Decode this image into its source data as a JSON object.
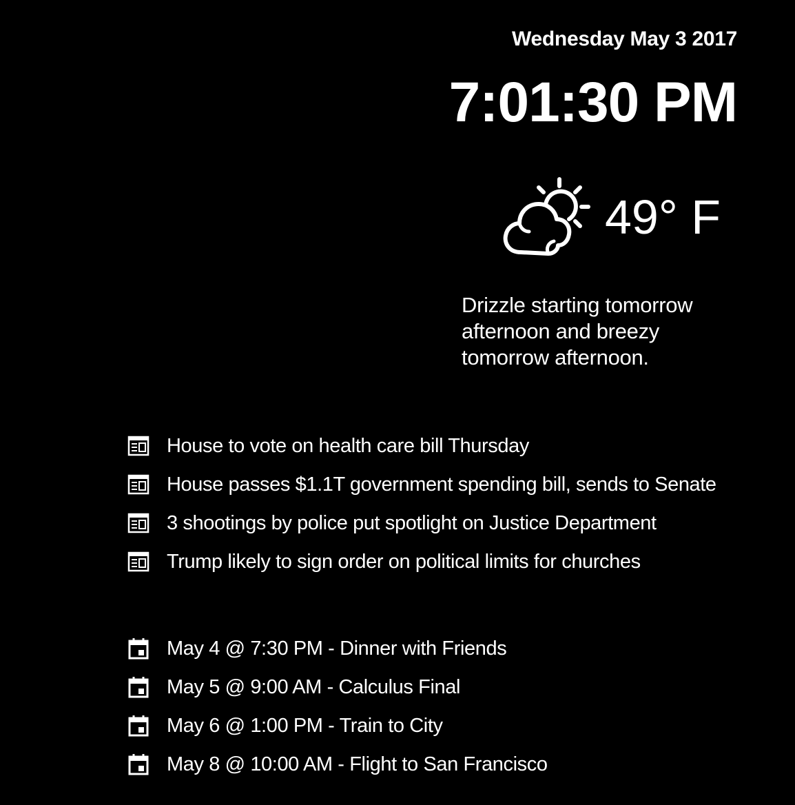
{
  "header": {
    "date": "Wednesday May 3 2017",
    "time": "7:01:30 PM"
  },
  "weather": {
    "icon": "partly-cloudy-icon",
    "temperature": "49° F",
    "forecast": "Drizzle starting tomorrow afternoon and breezy tomorrow afternoon."
  },
  "news": {
    "icon": "newspaper-icon",
    "items": [
      "House to vote on health care bill Thursday",
      "House passes $1.1T government spending bill, sends to Senate",
      "3 shootings by police put spotlight on Justice Department",
      "Trump likely to sign order on political limits for churches"
    ]
  },
  "events": {
    "icon": "calendar-icon",
    "items": [
      "May 4 @ 7:30 PM - Dinner with Friends",
      "May 5 @ 9:00 AM - Calculus Final",
      "May 6 @ 1:00 PM - Train to City",
      "May 8 @ 10:00 AM - Flight to San Francisco"
    ]
  },
  "colors": {
    "background": "#000000",
    "foreground": "#ffffff"
  }
}
